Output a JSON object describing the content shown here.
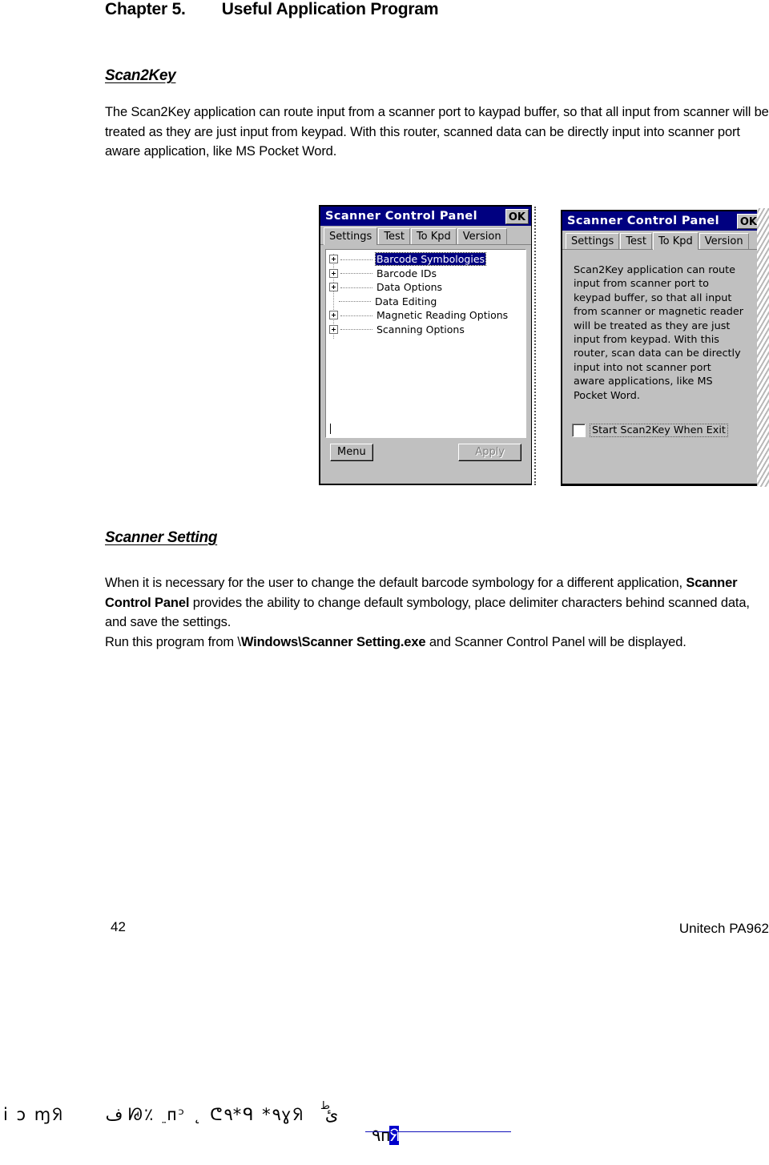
{
  "document": {
    "chapter_heading": "Chapter 5.        Useful Application Program",
    "page_number": "42",
    "brand_footer": "Unitech PA962",
    "sections": [
      {
        "heading": "Scan2Key",
        "body": "The Scan2Key application can route input from a scanner port to kaypad buffer, so that all input from scanner will be treated as they are just input from keypad. With this router, scanned data can be directly input into scanner port aware application, like MS Pocket Word."
      },
      {
        "heading": "Scanner Setting",
        "body_part1": "When it is necessary for the user to change the default barcode symbology for a different application, ",
        "body_bold1": "Scanner Control Panel",
        "body_part2": " provides the ability to change default symbology, place delimiter characters behind scanned data, and save the settings.",
        "body_part3": "Run this program from \\",
        "body_bold2": "Windows\\Scanner Setting.exe",
        "body_part4": " and Scanner Control Panel will be displayed."
      }
    ]
  },
  "screenshot_settings": {
    "title": "Scanner Control Panel",
    "ok_label": "OK",
    "tabs": [
      {
        "label": "Settings",
        "active": true
      },
      {
        "label": "Test",
        "active": false
      },
      {
        "label": "To Kpd",
        "active": false
      },
      {
        "label": "Version",
        "active": false
      }
    ],
    "tree_items": [
      {
        "label": "Barcode Symbologies",
        "expandable": true,
        "selected": true
      },
      {
        "label": "Barcode IDs",
        "expandable": true,
        "selected": false
      },
      {
        "label": "Data Options",
        "expandable": true,
        "selected": false
      },
      {
        "label": "Data Editing",
        "expandable": false,
        "selected": false
      },
      {
        "label": "Magnetic Reading Options",
        "expandable": true,
        "selected": false
      },
      {
        "label": "Scanning Options",
        "expandable": true,
        "selected": false
      }
    ],
    "menu_button": "Menu",
    "apply_button": "Apply"
  },
  "screenshot_tokpd": {
    "title": "Scanner Control Panel",
    "ok_label": "OK",
    "tabs": [
      {
        "label": "Settings",
        "active": false
      },
      {
        "label": "Test",
        "active": false
      },
      {
        "label": "To Kpd",
        "active": true
      },
      {
        "label": "Version",
        "active": false
      }
    ],
    "description": "Scan2Key application can route\ninput from scanner port to\nkeypad buffer, so that all input\nfrom scanner or magnetic reader\nwill be treated as they are just\ninput from keypad. With this\nrouter, scan data can be directly\ninput into not scanner port\naware applications, like MS\nPocket Word.",
    "checkbox_label": "Start Scan2Key When Exit",
    "checkbox_checked": false
  },
  "artifact": {
    "glyphs_left": "i ɔ ɱᖆ      ف ᘘ٪ ֵ ᴨᵓ ˛ ᕦ٩*᲼ᑫ *٩ɣᖆ   ئ",
    "glyphs_mid": "ط",
    "glyphs_right_plain": "٩ᴨ",
    "glyphs_right_highlight": "ᖆ"
  },
  "colors": {
    "titlebar": "#000080",
    "window_face": "#c0c0c0",
    "selection": "#000080",
    "link_rule": "#1111bb"
  }
}
